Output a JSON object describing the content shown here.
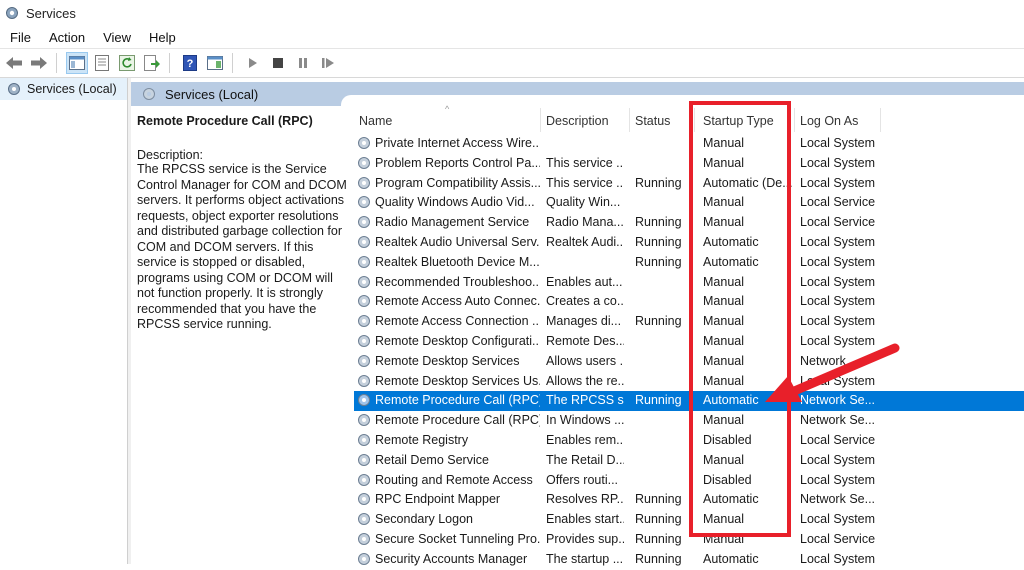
{
  "window": {
    "title": "Services"
  },
  "menu": [
    "File",
    "Action",
    "View",
    "Help"
  ],
  "tree": {
    "item": "Services (Local)"
  },
  "panel": {
    "title": "Services (Local)"
  },
  "description": {
    "service_name": "Remote Procedure Call (RPC)",
    "label": "Description:",
    "text": "The RPCSS service is the Service Control Manager for COM and DCOM servers. It performs object activations requests, object exporter resolutions and distributed garbage collection for COM and DCOM servers. If this service is stopped or disabled, programs using COM or DCOM will not function properly. It is strongly recommended that you have the RPCSS service running."
  },
  "columns": {
    "name": "Name",
    "description": "Description",
    "status": "Status",
    "startup": "Startup Type",
    "logon": "Log On As"
  },
  "rows": [
    {
      "name": "Private Internet Access Wire...",
      "description": "",
      "status": "",
      "startup": "Manual",
      "logon": "Local System"
    },
    {
      "name": "Problem Reports Control Pa...",
      "description": "This service ...",
      "status": "",
      "startup": "Manual",
      "logon": "Local System"
    },
    {
      "name": "Program Compatibility Assis...",
      "description": "This service ...",
      "status": "Running",
      "startup": "Automatic (De...",
      "logon": "Local System"
    },
    {
      "name": "Quality Windows Audio Vid...",
      "description": "Quality Win...",
      "status": "",
      "startup": "Manual",
      "logon": "Local Service"
    },
    {
      "name": "Radio Management Service",
      "description": "Radio Mana...",
      "status": "Running",
      "startup": "Manual",
      "logon": "Local Service"
    },
    {
      "name": "Realtek Audio Universal Serv...",
      "description": "Realtek Audi...",
      "status": "Running",
      "startup": "Automatic",
      "logon": "Local System"
    },
    {
      "name": "Realtek Bluetooth Device M...",
      "description": "",
      "status": "Running",
      "startup": "Automatic",
      "logon": "Local System"
    },
    {
      "name": "Recommended Troubleshoo...",
      "description": "Enables aut...",
      "status": "",
      "startup": "Manual",
      "logon": "Local System"
    },
    {
      "name": "Remote Access Auto Connec...",
      "description": "Creates a co...",
      "status": "",
      "startup": "Manual",
      "logon": "Local System"
    },
    {
      "name": "Remote Access Connection ...",
      "description": "Manages di...",
      "status": "Running",
      "startup": "Manual",
      "logon": "Local System"
    },
    {
      "name": "Remote Desktop Configurati...",
      "description": "Remote Des...",
      "status": "",
      "startup": "Manual",
      "logon": "Local System"
    },
    {
      "name": "Remote Desktop Services",
      "description": "Allows users ...",
      "status": "",
      "startup": "Manual",
      "logon": "Network..."
    },
    {
      "name": "Remote Desktop Services Us...",
      "description": "Allows the re...",
      "status": "",
      "startup": "Manual",
      "logon": "Local System"
    },
    {
      "name": "Remote Procedure Call (RPC)",
      "description": "The RPCSS s...",
      "status": "Running",
      "startup": "Automatic",
      "logon": "Network Se...",
      "selected": true
    },
    {
      "name": "Remote Procedure Call (RPC)...",
      "description": "In Windows ...",
      "status": "",
      "startup": "Manual",
      "logon": "Network Se..."
    },
    {
      "name": "Remote Registry",
      "description": "Enables rem...",
      "status": "",
      "startup": "Disabled",
      "logon": "Local Service"
    },
    {
      "name": "Retail Demo Service",
      "description": "The Retail D...",
      "status": "",
      "startup": "Manual",
      "logon": "Local System"
    },
    {
      "name": "Routing and Remote Access",
      "description": "Offers routi...",
      "status": "",
      "startup": "Disabled",
      "logon": "Local System"
    },
    {
      "name": "RPC Endpoint Mapper",
      "description": "Resolves RP...",
      "status": "Running",
      "startup": "Automatic",
      "logon": "Network Se..."
    },
    {
      "name": "Secondary Logon",
      "description": "Enables start...",
      "status": "Running",
      "startup": "Manual",
      "logon": "Local System"
    },
    {
      "name": "Secure Socket Tunneling Pro...",
      "description": "Provides sup...",
      "status": "Running",
      "startup": "Manual",
      "logon": "Local Service"
    },
    {
      "name": "Security Accounts Manager",
      "description": "The startup ...",
      "status": "Running",
      "startup": "Automatic",
      "logon": "Local System"
    }
  ],
  "colors": {
    "selection": "#0078d7",
    "header_band": "#b9cce3",
    "highlight_box": "#e8202a"
  },
  "toolbar_icons": [
    "back-arrow-icon",
    "forward-arrow-icon",
    "console-tree-icon",
    "properties-icon",
    "refresh-icon",
    "export-list-icon",
    "help-icon",
    "view-icon",
    "start-service-icon",
    "stop-service-icon",
    "pause-service-icon",
    "restart-service-icon"
  ]
}
